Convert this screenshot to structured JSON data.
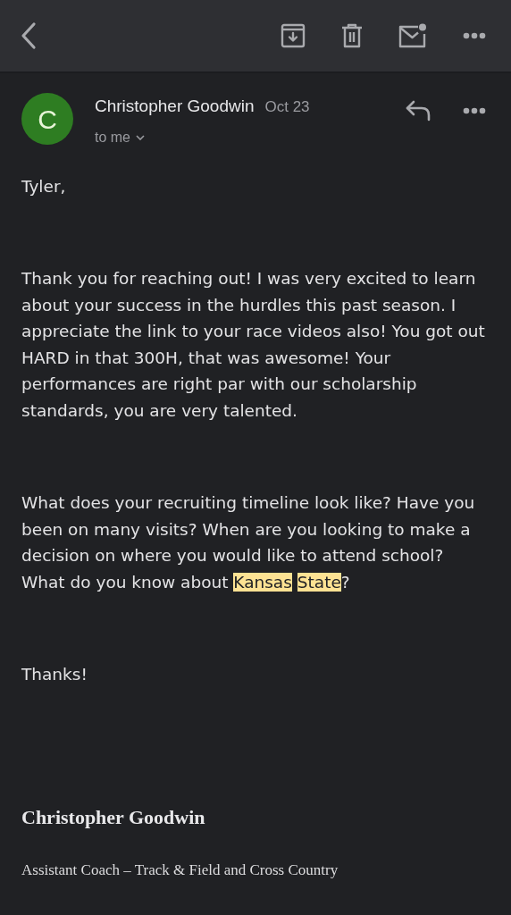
{
  "sender": {
    "initial": "C",
    "name": "Christopher Goodwin",
    "date": "Oct 23",
    "recipient": "to me"
  },
  "body": [
    {
      "segments": [
        {
          "text": "Tyler,",
          "highlighted": false
        }
      ]
    },
    {
      "segments": [
        {
          "text": "Thank you for reaching out! I was very excited to learn about your success in the hurdles this past season. I appreciate the link to your race videos also! You got out HARD in that 300H, that was awesome! Your performances are right par with our scholarship standards, you are very talented.",
          "highlighted": false
        }
      ]
    },
    {
      "segments": [
        {
          "text": "What does your recruiting timeline look like? Have you been on many visits? When are you looking to make a decision on where you would like to attend school? What do you know about ",
          "highlighted": false
        },
        {
          "text": "Kansas",
          "highlighted": true
        },
        {
          "text": "State",
          "highlighted": true
        },
        {
          "text": "?",
          "highlighted": false
        }
      ]
    },
    {
      "segments": [
        {
          "text": "Thanks!",
          "highlighted": false
        }
      ]
    }
  ],
  "signature": {
    "name": "Christopher Goodwin",
    "title": "Assistant Coach – Track & Field and Cross Country"
  }
}
